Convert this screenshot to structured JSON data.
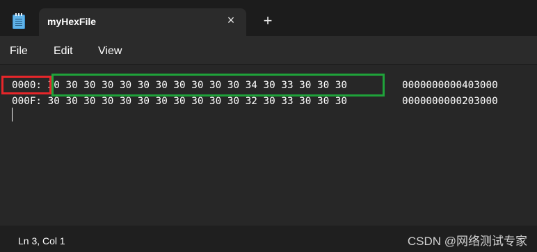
{
  "app": {
    "icon": "notepad-icon"
  },
  "tab": {
    "title": "myHexFile",
    "close_icon": "×",
    "new_tab_icon": "+"
  },
  "menu": {
    "items": [
      "File",
      "Edit",
      "View"
    ]
  },
  "editor": {
    "lines": [
      {
        "address": "0000:",
        "hex": "30 30 30 30 30 30 30 30 30 30 30 34 30 33 30 30 30",
        "ascii": "0000000000403000"
      },
      {
        "address": "000F:",
        "hex": "30 30 30 30 30 30 30 30 30 30 30 32 30 33 30 30 30",
        "ascii": "0000000000203000"
      }
    ],
    "highlight_colors": {
      "address_box": "#e6262a",
      "hex_box": "#1fa33a"
    }
  },
  "status": {
    "position": "Ln 3, Col 1",
    "watermark": "CSDN @网络测试专家"
  }
}
